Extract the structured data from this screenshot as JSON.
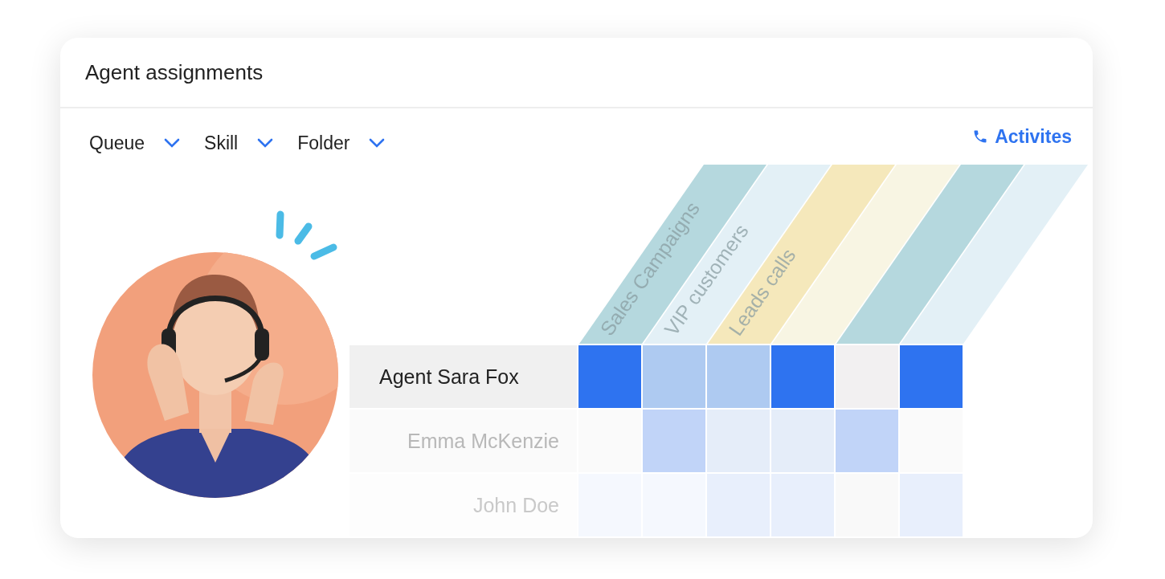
{
  "title": "Agent assignments",
  "filters": [
    "Queue",
    "Skill",
    "Folder"
  ],
  "activities_link": "Activites",
  "columns": [
    {
      "label": "Sales Campaigns",
      "color": "#b5d8de"
    },
    {
      "label": "VIP customers",
      "color": "#e3f0f6"
    },
    {
      "label": "Leads calls",
      "color": "#f5e8bb"
    },
    {
      "color": "#f8f5e3"
    },
    {
      "color": "#b5d8de"
    },
    {
      "color": "#e3f0f6"
    }
  ],
  "agents": [
    {
      "name": "Agent Sara Fox",
      "selected": true,
      "cells": [
        {
          "color": "#2e73f0"
        },
        {
          "color": "#aecaf1"
        },
        {
          "color": "#aecaf1"
        },
        {
          "color": "#2e73f0"
        },
        {
          "color": "#f2f0f1"
        },
        {
          "color": "#2e73f0"
        }
      ]
    },
    {
      "name": "Emma McKenzie",
      "selected": false,
      "cells": [
        {
          "color": "#fafafa"
        },
        {
          "color": "#c1d4f8"
        },
        {
          "color": "#e5edf9"
        },
        {
          "color": "#e5edf9"
        },
        {
          "color": "#c1d4f8"
        },
        {
          "color": "#fafafa"
        }
      ]
    },
    {
      "name": "John Doe",
      "selected": false,
      "cells": [
        {
          "color": "#f5f8fe"
        },
        {
          "color": "#f5f8fe"
        },
        {
          "color": "#e8effc"
        },
        {
          "color": "#e8effc"
        },
        {
          "color": "#f9f9f9"
        },
        {
          "color": "#e8effc"
        }
      ]
    }
  ]
}
